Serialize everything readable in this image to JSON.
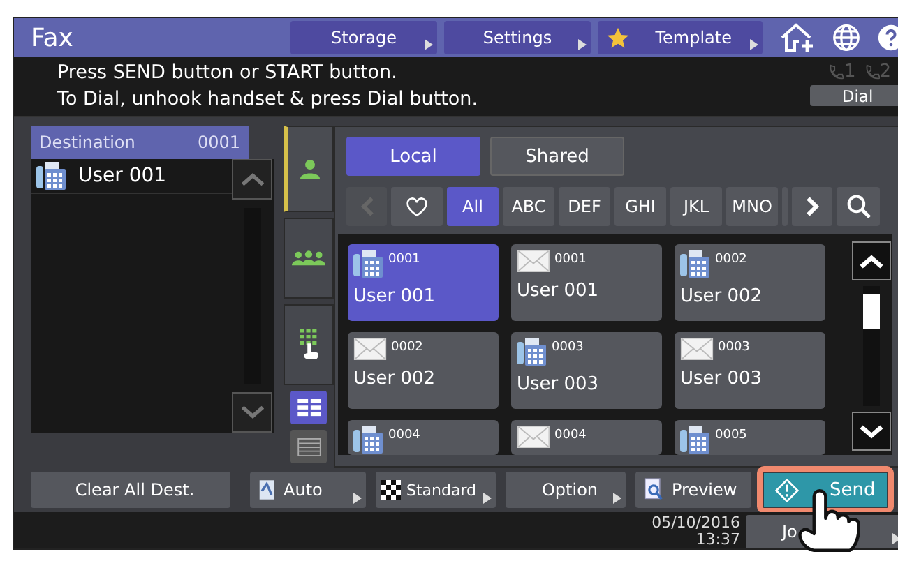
{
  "window": {
    "title": "Fax"
  },
  "header_buttons": [
    {
      "label": "Storage",
      "kind": "menu"
    },
    {
      "label": "Settings",
      "kind": "menu"
    },
    {
      "label": "Template",
      "kind": "star"
    }
  ],
  "message": [
    "Press SEND button or START button.",
    "To Dial, unhook handset & press Dial button."
  ],
  "lines": [
    "1",
    "2"
  ],
  "dial_button": "Dial",
  "destination": {
    "title": "Destination",
    "count": "0001",
    "items": [
      {
        "kind": "fax",
        "name": "User 001"
      }
    ]
  },
  "side_tabs": [
    {
      "kind": "person",
      "selected": true
    },
    {
      "kind": "group",
      "selected": false
    },
    {
      "kind": "keypad",
      "selected": false
    }
  ],
  "view_toggles": [
    {
      "kind": "grid",
      "selected": true
    },
    {
      "kind": "list",
      "selected": false
    }
  ],
  "source_tabs": [
    {
      "label": "Local",
      "selected": true
    },
    {
      "label": "Shared",
      "selected": false
    }
  ],
  "filters": [
    {
      "kind": "favorite",
      "selected": false
    },
    {
      "kind": "text",
      "label": "All",
      "selected": true
    },
    {
      "kind": "text",
      "label": "ABC",
      "selected": false
    },
    {
      "kind": "text",
      "label": "DEF",
      "selected": false
    },
    {
      "kind": "text",
      "label": "GHI",
      "selected": false
    },
    {
      "kind": "text",
      "label": "JKL",
      "selected": false
    },
    {
      "kind": "text",
      "label": "MNO",
      "selected": false
    }
  ],
  "cards": [
    {
      "kind": "fax",
      "number": "0001",
      "name": "User 001",
      "selected": true
    },
    {
      "kind": "email",
      "number": "0001",
      "name": "User 001",
      "selected": false
    },
    {
      "kind": "fax",
      "number": "0002",
      "name": "User 002",
      "selected": false
    },
    {
      "kind": "email",
      "number": "0002",
      "name": "User 002",
      "selected": false
    },
    {
      "kind": "fax",
      "number": "0003",
      "name": "User 003",
      "selected": false
    },
    {
      "kind": "email",
      "number": "0003",
      "name": "User 003",
      "selected": false
    },
    {
      "kind": "fax",
      "number": "0004",
      "selected": false
    },
    {
      "kind": "email",
      "number": "0004",
      "selected": false
    },
    {
      "kind": "fax",
      "number": "0005",
      "selected": false
    }
  ],
  "bottom_buttons": [
    {
      "label": "Clear All Dest.",
      "kind": "plain"
    },
    {
      "label": "Auto",
      "kind": "auto"
    },
    {
      "label": "Standard",
      "kind": "standard"
    },
    {
      "label": "Option",
      "kind": "option"
    },
    {
      "label": "Preview",
      "kind": "preview"
    }
  ],
  "send_button": "Send",
  "date": "05/10/2016",
  "time": "13:37",
  "job_button": "Jo"
}
